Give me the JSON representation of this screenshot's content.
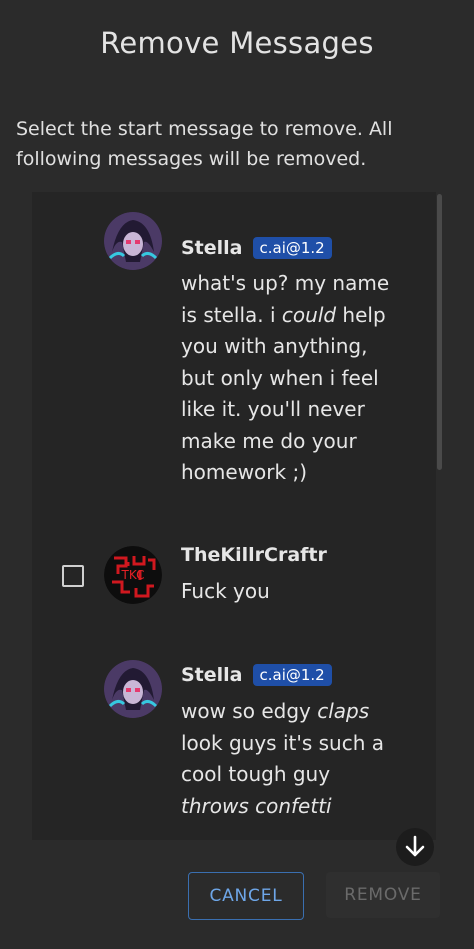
{
  "dialog": {
    "title": "Remove Messages",
    "subtitle": "Select the start message to remove. All following messages will be removed."
  },
  "messages": [
    {
      "author": "Stella",
      "badge": "c.ai@1.2",
      "avatar_icon": "stella-avatar-icon",
      "segments": [
        {
          "t": "what's up? my name is stella. i ",
          "i": false
        },
        {
          "t": "could",
          "i": true
        },
        {
          "t": " help you with anything, but only when i feel like it. you'll never make me do your homework ;)",
          "i": false
        }
      ],
      "selectable": false
    },
    {
      "author": "TheKillrCraftr",
      "badge": "",
      "avatar_icon": "tkc-avatar-icon",
      "avatar_text": "TKC",
      "segments": [
        {
          "t": "Fuck you",
          "i": false
        }
      ],
      "selectable": true
    },
    {
      "author": "Stella",
      "badge": "c.ai@1.2",
      "avatar_icon": "stella-avatar-icon",
      "segments": [
        {
          "t": "wow so edgy ",
          "i": false
        },
        {
          "t": "claps",
          "i": true
        },
        {
          "t": " look guys it's such a cool tough guy ",
          "i": false
        },
        {
          "t": "throws confetti",
          "i": true
        }
      ],
      "selectable": false
    }
  ],
  "actions": {
    "cancel_label": "CANCEL",
    "remove_label": "REMOVE"
  },
  "colors": {
    "background": "#2b2b2b",
    "list_background": "#252525",
    "badge": "#1f4fa8",
    "cancel_accent": "#6ea6e8"
  }
}
